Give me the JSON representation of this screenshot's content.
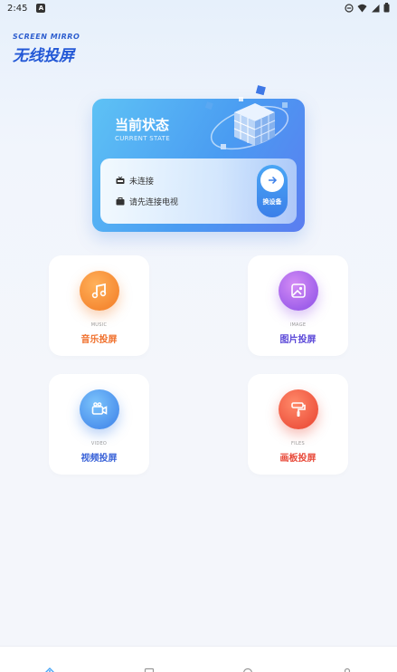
{
  "status_bar": {
    "time": "2:45"
  },
  "brand": {
    "en": "SCREEN MIRRO",
    "cn": "无线投屏"
  },
  "state_card": {
    "title": "当前状态",
    "subtitle": "CURRENT STATE",
    "connection_status": "未连接",
    "hint": "请先连接电视",
    "switch_label": "换设备"
  },
  "tiles": [
    {
      "en": "MUSIC",
      "cn": "音乐投屏",
      "icon": "music-note-icon",
      "color": "#f0702c"
    },
    {
      "en": "IMAGE",
      "cn": "图片投屏",
      "icon": "image-icon",
      "color": "#5a47d8"
    },
    {
      "en": "VIDEO",
      "cn": "视频投屏",
      "icon": "video-camera-icon",
      "color": "#3a63d8"
    },
    {
      "en": "FILES",
      "cn": "画板投屏",
      "icon": "paint-roller-icon",
      "color": "#e84a3a"
    }
  ],
  "bottom_nav": [
    "home-icon",
    "cast-icon",
    "discover-icon",
    "profile-icon"
  ]
}
